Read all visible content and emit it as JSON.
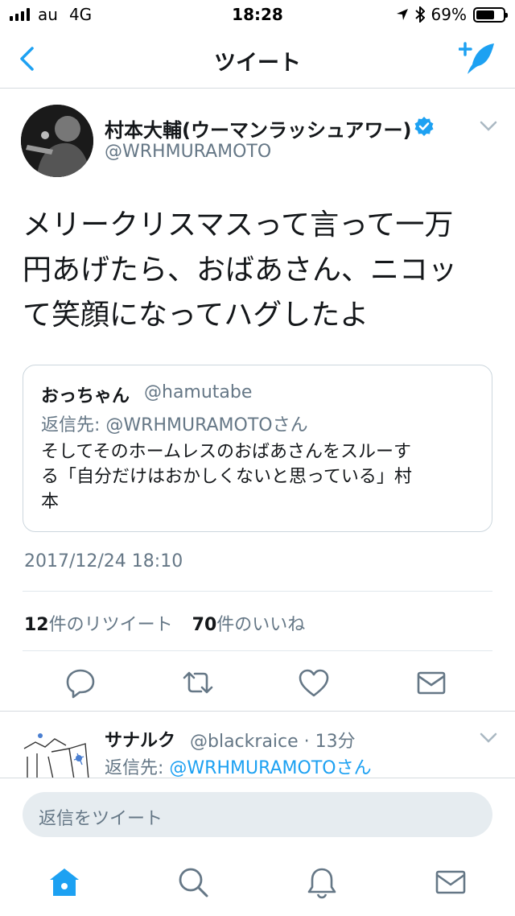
{
  "status_bar": {
    "carrier": "au",
    "network": "4G",
    "time": "18:28",
    "battery": "69%",
    "battery_level": 0.69
  },
  "nav": {
    "title": "ツイート"
  },
  "tweet": {
    "author_name": "村本大輔(ウーマンラッシュアワー)",
    "author_handle": "@WRHMURAMOTO",
    "text_lines": [
      "メリークリスマスって言って一万",
      "円あげたら、おばあさん、ニコッ",
      "て笑顔になってハグしたよ"
    ],
    "quote": {
      "name": "おっちゃん",
      "handle": "@hamutabe",
      "reply_to": "返信先: @WRHMURAMOTOさん",
      "text_lines": [
        "そしてそのホームレスのおばあさんをスルーす",
        "る「自分だけはおかしくないと思っている」村",
        "本"
      ]
    },
    "timestamp": "2017/12/24 18:10",
    "retweet_count": "12",
    "retweet_label": "件のリツイート",
    "like_count": "70",
    "like_label": "件のいいね"
  },
  "reply": {
    "name": "サナルク",
    "handle_time": "@blackraice · 13分",
    "reply_prefix": "返信先: ",
    "reply_to": "@WRHMURAMOTOさん"
  },
  "reply_input": {
    "placeholder": "返信をツイート"
  },
  "colors": {
    "accent": "#1da1f2",
    "muted": "#657786",
    "icon": "#657786"
  }
}
